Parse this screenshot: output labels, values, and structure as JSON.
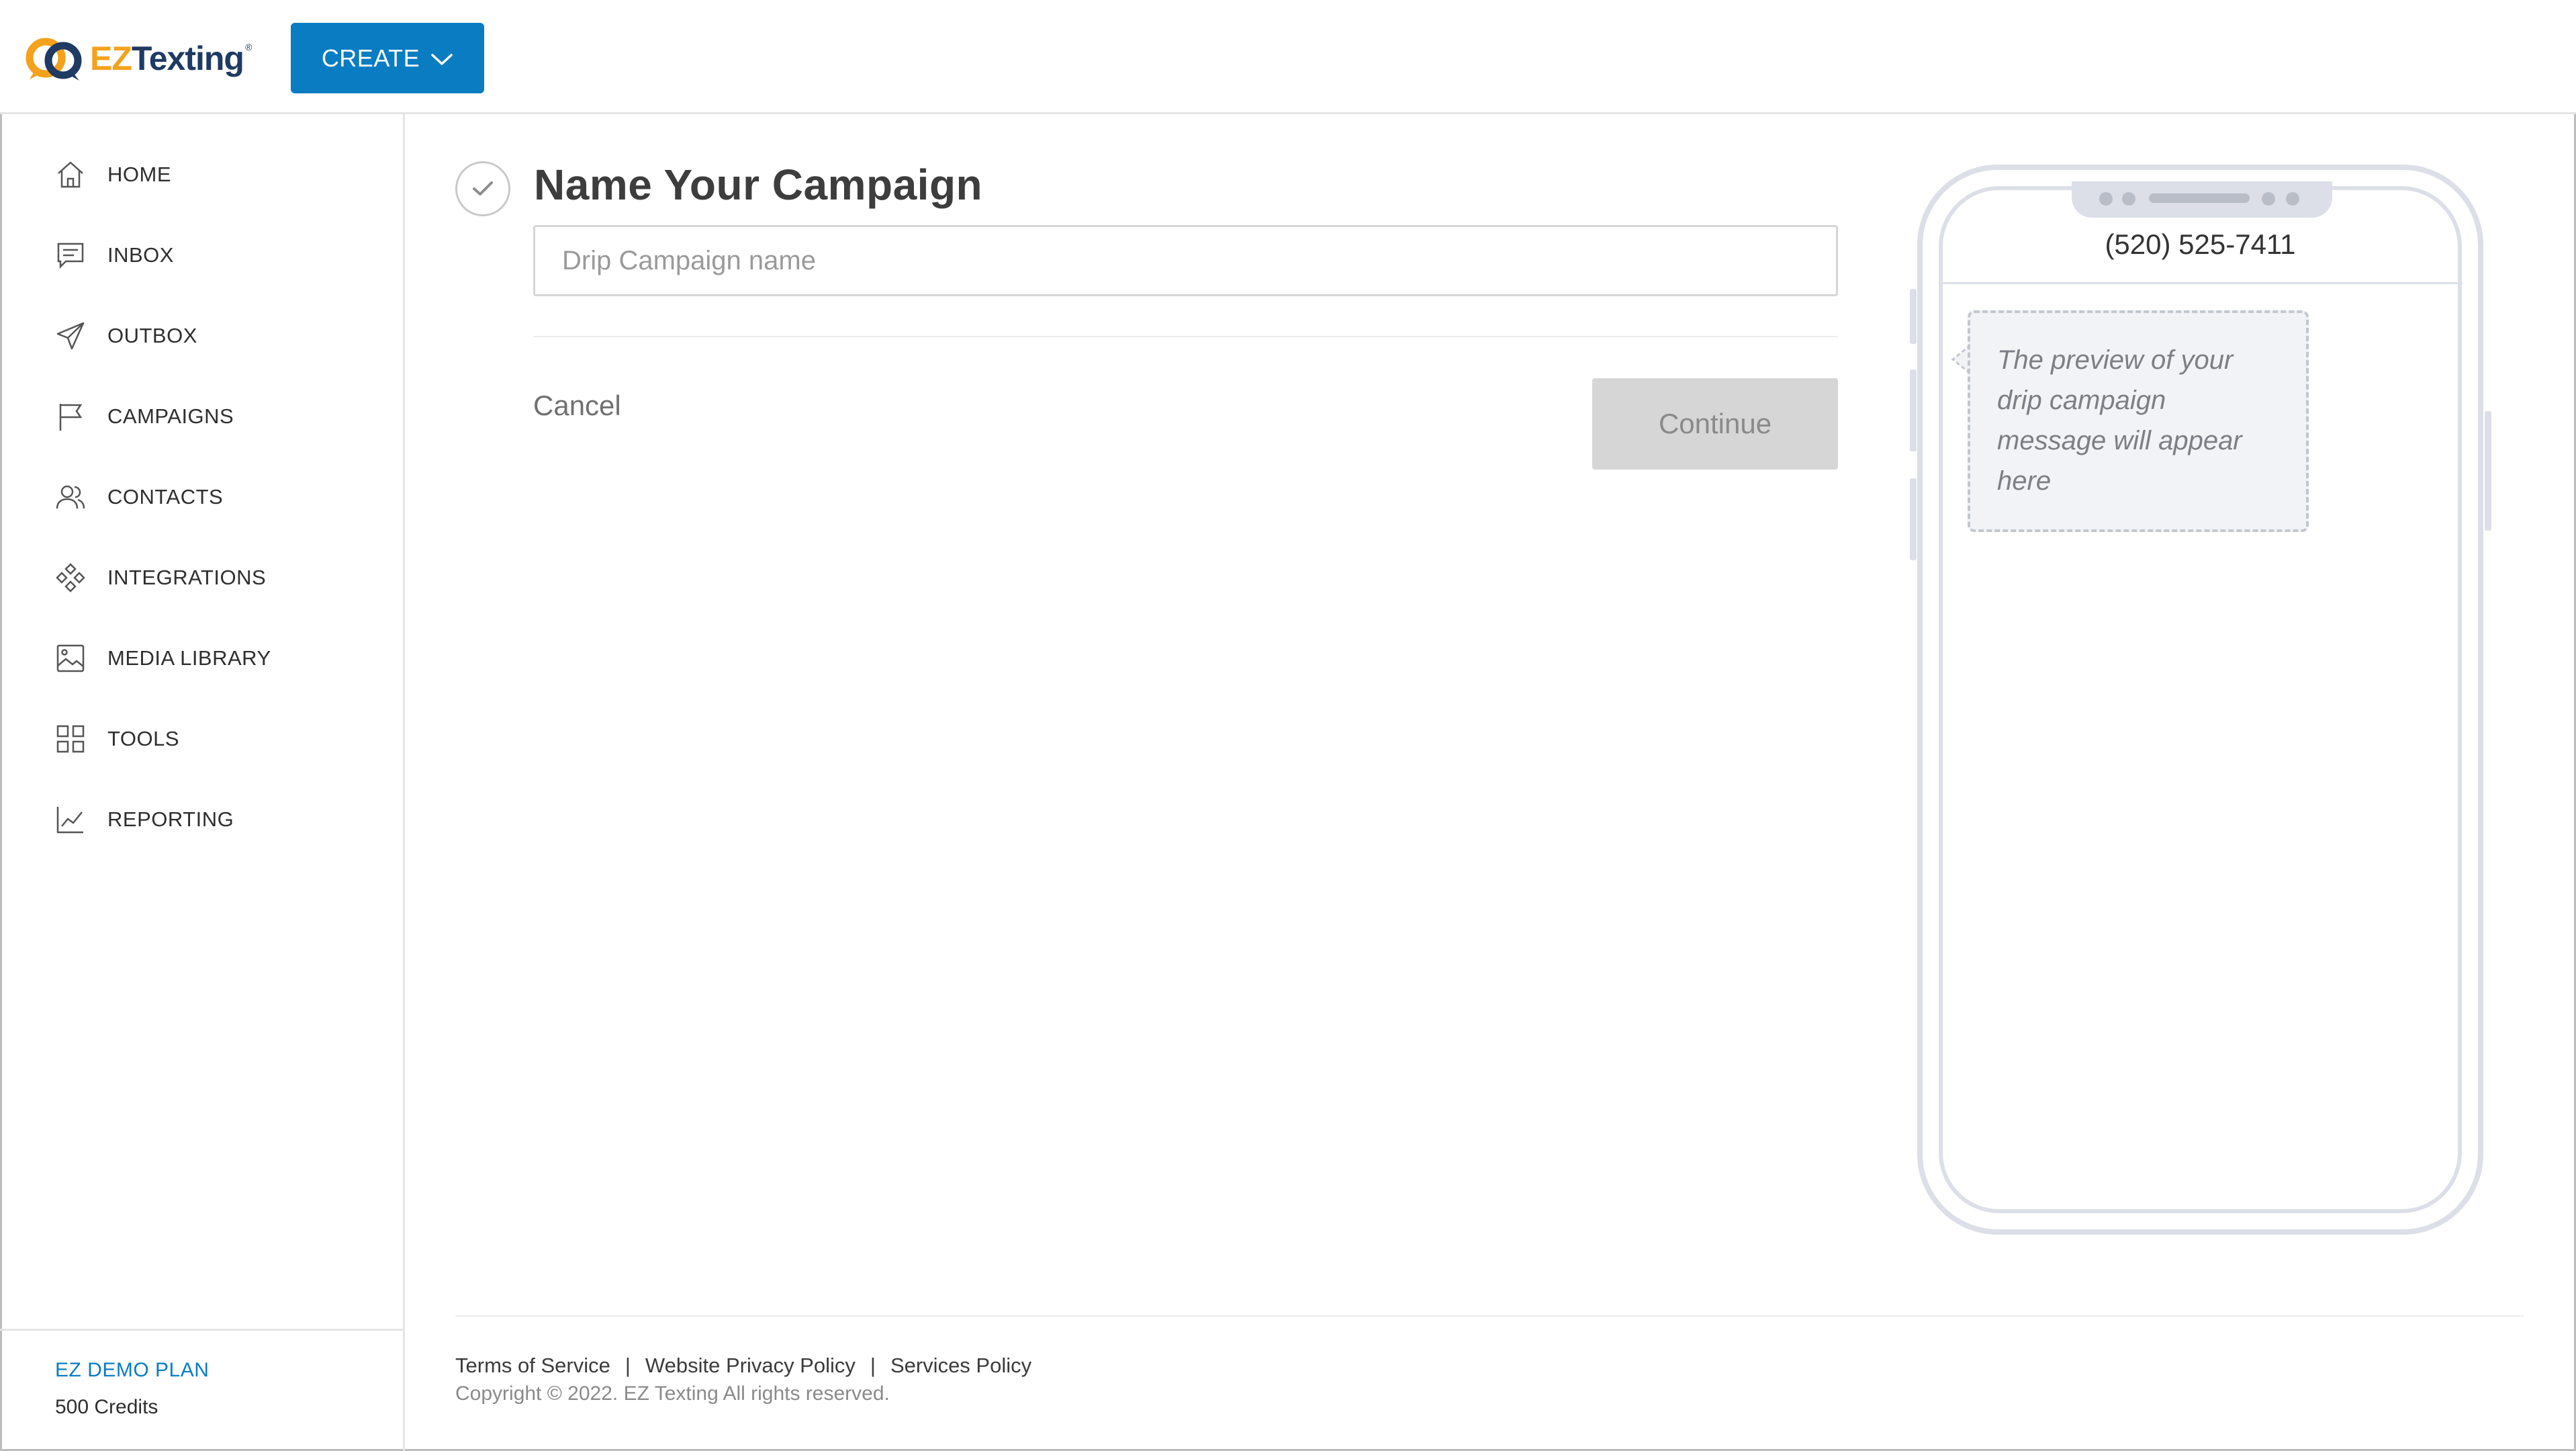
{
  "header": {
    "logo_ez": "EZ",
    "logo_texting": "Texting",
    "logo_reg": "®",
    "create_label": "CREATE"
  },
  "sidebar": {
    "items": [
      {
        "label": "HOME",
        "icon": "home-icon"
      },
      {
        "label": "INBOX",
        "icon": "inbox-icon"
      },
      {
        "label": "OUTBOX",
        "icon": "send-icon"
      },
      {
        "label": "CAMPAIGNS",
        "icon": "flag-icon"
      },
      {
        "label": "CONTACTS",
        "icon": "contacts-icon"
      },
      {
        "label": "INTEGRATIONS",
        "icon": "integrations-icon"
      },
      {
        "label": "MEDIA LIBRARY",
        "icon": "image-icon"
      },
      {
        "label": "TOOLS",
        "icon": "grid-icon"
      },
      {
        "label": "REPORTING",
        "icon": "chart-icon"
      }
    ],
    "plan_name": "EZ DEMO PLAN",
    "plan_credits": "500 Credits"
  },
  "main": {
    "title": "Name Your Campaign",
    "name_placeholder": "Drip Campaign name",
    "name_value": "",
    "cancel_label": "Cancel",
    "continue_label": "Continue"
  },
  "preview": {
    "phone_number": "(520) 525-7411",
    "placeholder_text": "The preview of your drip campaign message will appear here"
  },
  "footer": {
    "terms": "Terms of Service",
    "privacy": "Website Privacy Policy",
    "services": "Services Policy",
    "separator": "|",
    "copyright": "Copyright © 2022. EZ Texting All rights reserved."
  },
  "colors": {
    "accent": "#0a7cc1",
    "logo_orange": "#f4a21c",
    "logo_navy": "#1f3a63",
    "disabled": "#d6d6d6"
  }
}
